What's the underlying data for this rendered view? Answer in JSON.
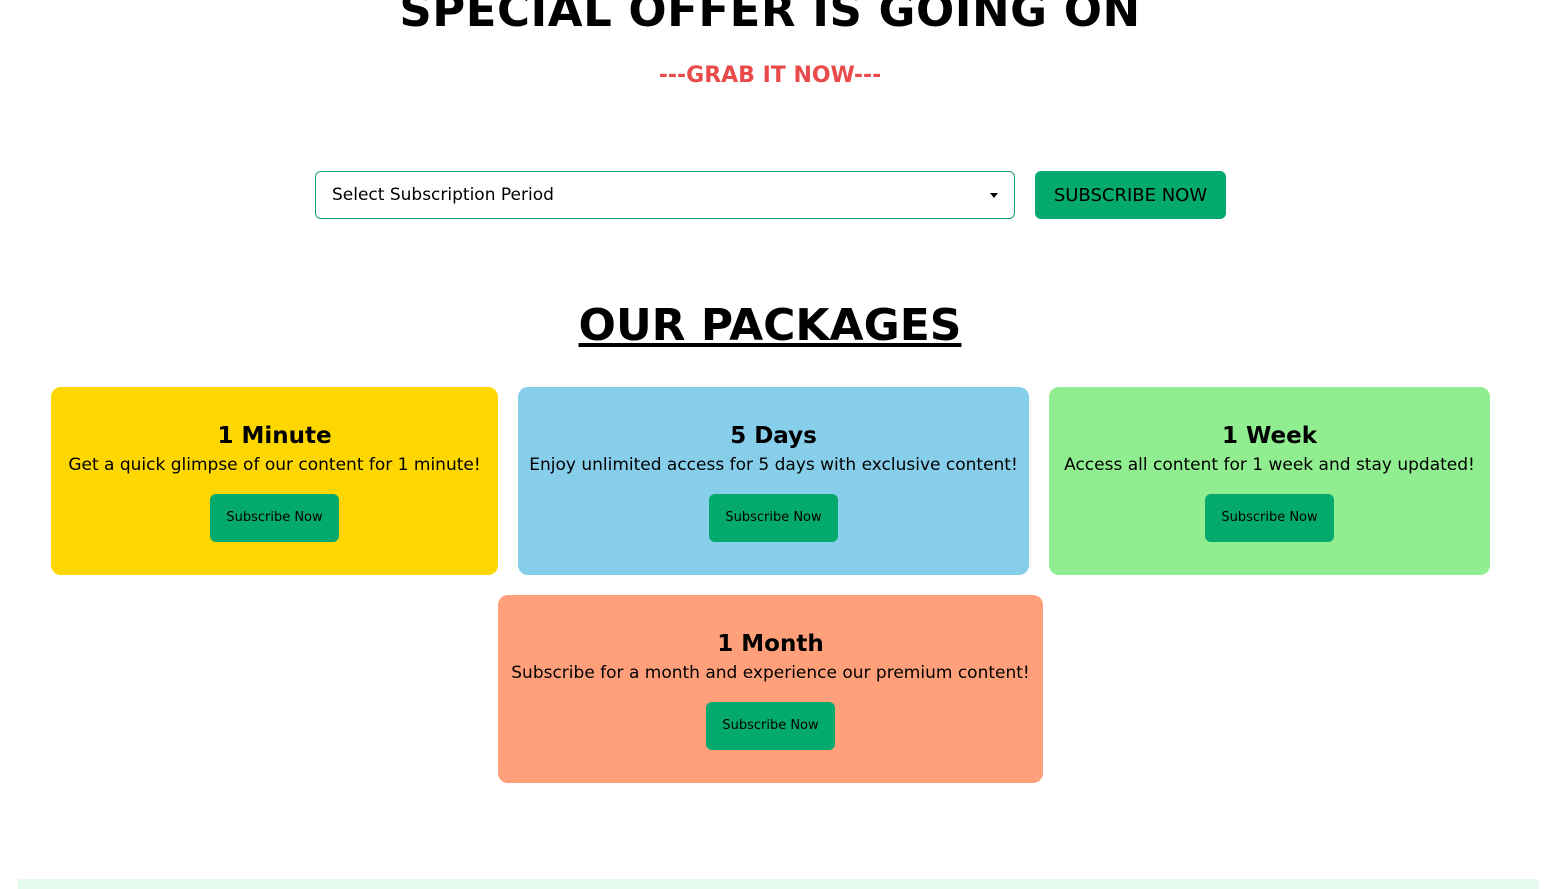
{
  "hero": {
    "title": "SPECIAL OFFER IS GOING ON",
    "subtitle": "---GRAB IT NOW---"
  },
  "subscribe_form": {
    "select_value": "Select Subscription Period",
    "button_label": "SUBSCRIBE NOW"
  },
  "packages": {
    "title": "OUR PACKAGES",
    "items": [
      {
        "name": "1 Minute",
        "description": "Get a quick glimpse of our content for 1 minute!",
        "button_label": "Subscribe Now",
        "color": "#ffd700"
      },
      {
        "name": "5 Days",
        "description": "Enjoy unlimited access for 5 days with exclusive content!",
        "button_label": "Subscribe Now",
        "color": "#87ceeb"
      },
      {
        "name": "1 Week",
        "description": "Access all content for 1 week and stay updated!",
        "button_label": "Subscribe Now",
        "color": "#90ee90"
      },
      {
        "name": "1 Month",
        "description": "Subscribe for a month and experience our premium content!",
        "button_label": "Subscribe Now",
        "color": "#ffa07a"
      }
    ]
  },
  "colors": {
    "accent": "#04aa6d",
    "subtitle": "#e94b4b",
    "footer": "#e5fbef"
  },
  "icons": {
    "select_caret": "chevron-down-icon"
  }
}
